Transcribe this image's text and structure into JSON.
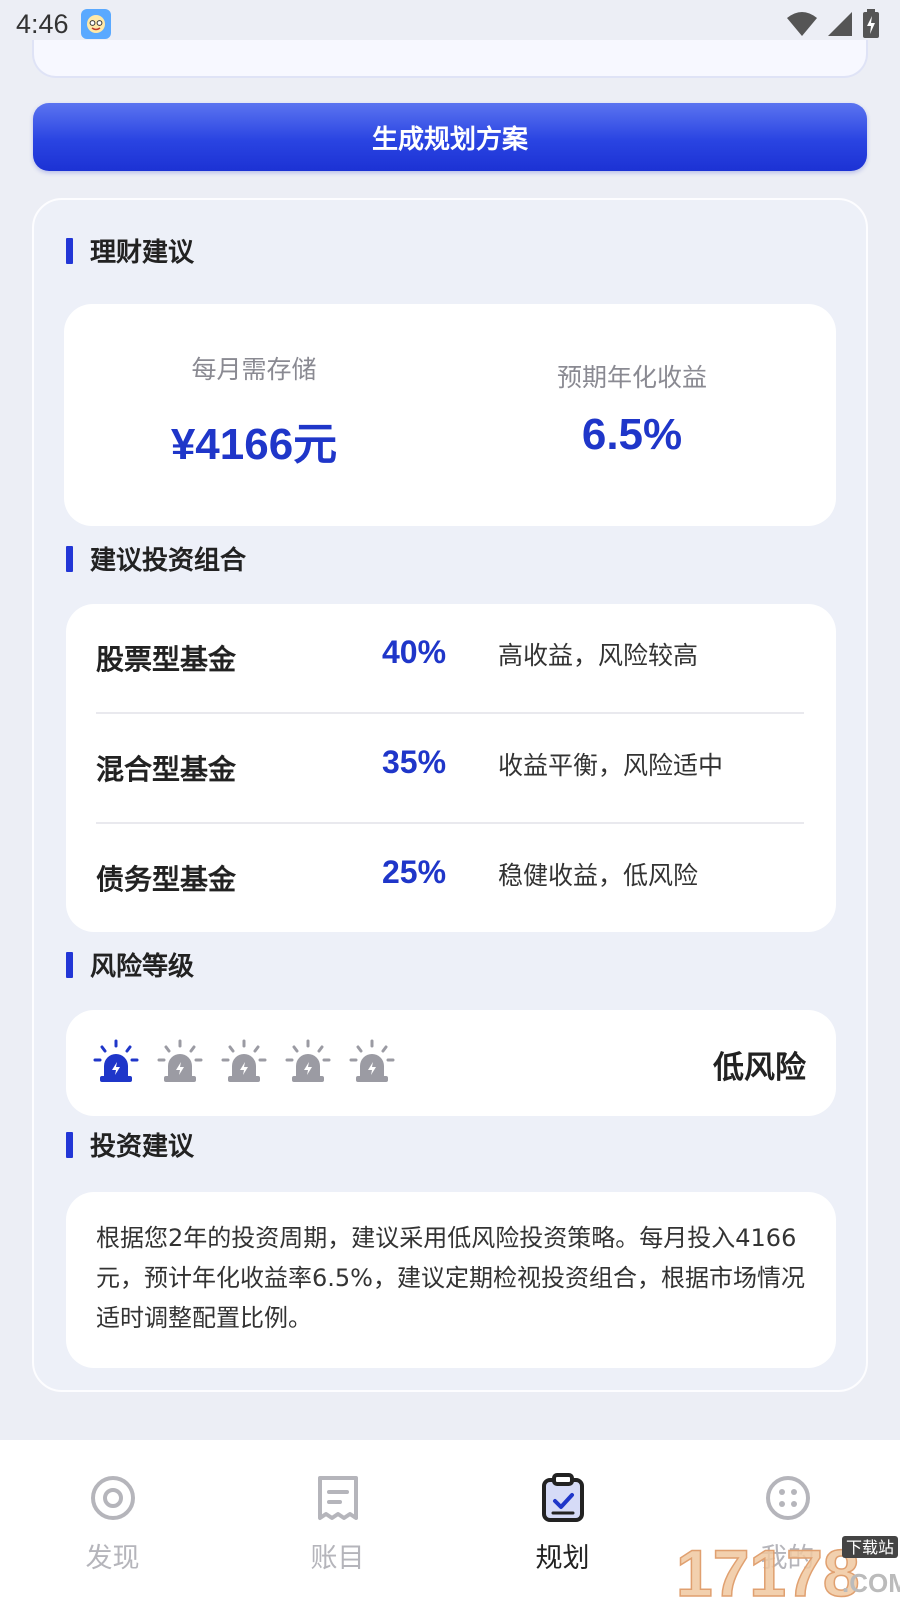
{
  "status_bar": {
    "time": "4:46"
  },
  "generate_button": {
    "label": "生成规划方案"
  },
  "sections": {
    "financial_advice": "理财建议",
    "portfolio": "建议投资组合",
    "risk_level": "风险等级",
    "investment_advice": "投资建议"
  },
  "summary": {
    "monthly_saving_label": "每月需存储",
    "monthly_saving_value": "¥4166元",
    "expected_return_label": "预期年化收益",
    "expected_return_value": "6.5%"
  },
  "portfolio": [
    {
      "name": "股票型基金",
      "percent": "40%",
      "desc": "高收益，风险较高"
    },
    {
      "name": "混合型基金",
      "percent": "35%",
      "desc": "收益平衡，风险适中"
    },
    {
      "name": "债务型基金",
      "percent": "25%",
      "desc": "稳健收益，低风险"
    }
  ],
  "risk": {
    "label": "低风险",
    "level": 1,
    "max_level": 5,
    "icon": "siren-icon",
    "active_color": "#1f36c9",
    "inactive_color": "#9b9ba3"
  },
  "advice_text": "根据您2年的投资周期，建议采用低风险投资策略。每月投入4166元，预计年化收益率6.5%，建议定期检视投资组合，根据市场情况适时调整配置比例。",
  "bottom_nav": [
    {
      "label": "发现",
      "icon": "compass-icon",
      "active": false
    },
    {
      "label": "账目",
      "icon": "receipt-icon",
      "active": false
    },
    {
      "label": "规划",
      "icon": "clipboard-check-icon",
      "active": true
    },
    {
      "label": "我的",
      "icon": "grid-dots-icon",
      "active": false
    }
  ],
  "watermark": {
    "text": "17178",
    "sub": "下载站",
    "domain": ".COM"
  },
  "colors": {
    "accent": "#1f36c9",
    "button": "#2a44e2",
    "background": "#eceef5"
  }
}
